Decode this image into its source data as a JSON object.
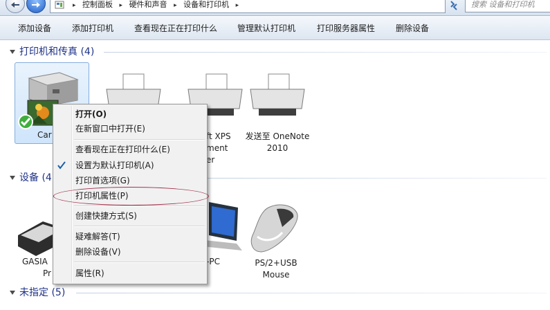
{
  "address_bar": {
    "breadcrumbs": [
      "控制面板",
      "硬件和声音",
      "设备和打印机"
    ],
    "search_placeholder": "搜索 设备和打印机"
  },
  "toolbar": {
    "items": [
      "添加设备",
      "添加打印机",
      "查看现在正在打印什么",
      "管理默认打印机",
      "打印服务器属性",
      "删除设备"
    ]
  },
  "groups": {
    "printers": {
      "title": "打印机和传真 (4)",
      "devices": [
        {
          "label_line1": "Car",
          "label_line2": "",
          "icon": "printer-icon",
          "default": true
        },
        {
          "label_line1": "",
          "label_line2": "",
          "icon": "printer-icon"
        },
        {
          "label_line1": "ft XPS",
          "label_line2": "ment",
          "label_line3": "er",
          "icon": "printer-icon"
        },
        {
          "label_line1": "发送至 OneNote",
          "label_line2": "2010",
          "icon": "printer-icon"
        }
      ]
    },
    "devices": {
      "title": "设备 (4",
      "devices": [
        {
          "label_line1": "GASIA",
          "label_line2": "Pr",
          "icon": "keyboard-icon"
        },
        {
          "label_line1": "-PC",
          "label_line2": "",
          "icon": "laptop-icon"
        },
        {
          "label_line1": "PS/2+USB",
          "label_line2": "Mouse",
          "icon": "mouse-icon"
        }
      ]
    },
    "unspecified": {
      "title": "未指定 (5)"
    }
  },
  "context_menu": {
    "items": [
      {
        "label": "打开(O)",
        "bold": true
      },
      {
        "label": "在新窗口中打开(E)"
      },
      {
        "label": "查看现在正在打印什么(E)"
      },
      {
        "label": "设置为默认打印机(A)",
        "checked": true
      },
      {
        "label": "打印首选项(G)"
      },
      {
        "label": "打印机属性(P)",
        "circled": true
      },
      {
        "label": "创建快捷方式(S)"
      },
      {
        "label": "疑难解答(T)"
      },
      {
        "label": "删除设备(V)"
      },
      {
        "label": "属性(R)"
      }
    ]
  },
  "colors": {
    "group_header": "#1e3287",
    "highlight_circle": "#a0344e",
    "selection": "#cfe5fb"
  }
}
